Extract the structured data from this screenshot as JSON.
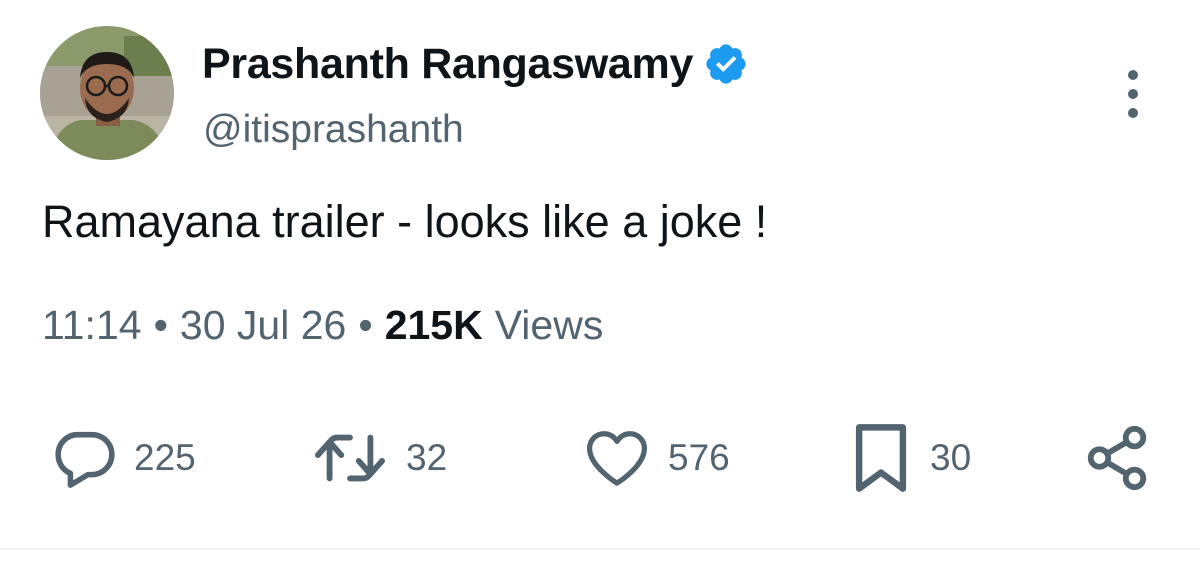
{
  "author": {
    "display_name": "Prashanth Rangaswamy",
    "handle": "@itisprashanth",
    "verified": true
  },
  "tweet": {
    "text": "Ramayana trailer - looks like a joke !",
    "time": "11:14",
    "date": "30 Jul 26",
    "separator": "•",
    "views_count": "215K",
    "views_label": "Views"
  },
  "actions": {
    "replies": "225",
    "reposts": "32",
    "likes": "576",
    "bookmarks": "30"
  },
  "icons": {
    "reply": "reply-icon",
    "repost": "repost-icon",
    "like": "heart-icon",
    "bookmark": "bookmark-icon",
    "share": "share-icon",
    "more": "more-icon",
    "verified": "verified-badge-icon"
  },
  "colors": {
    "verified_blue": "#1d9bf0",
    "secondary_text": "#536471",
    "primary_text": "#0f1419"
  }
}
